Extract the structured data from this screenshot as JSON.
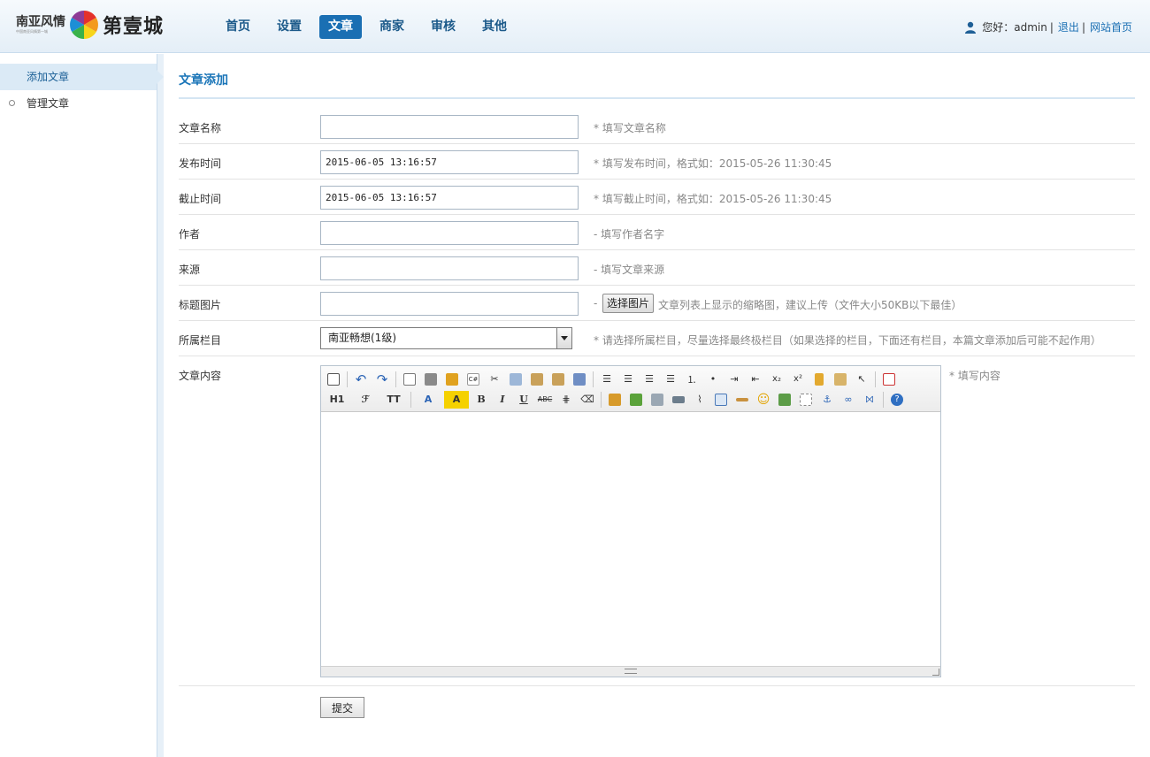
{
  "header": {
    "logo_left": "南亚风情",
    "logo_tagline": "中国南亚风情第一城",
    "logo_right": "第壹城",
    "nav": [
      {
        "label": "首页",
        "active": false
      },
      {
        "label": "设置",
        "active": false
      },
      {
        "label": "文章",
        "active": true
      },
      {
        "label": "商家",
        "active": false
      },
      {
        "label": "审核",
        "active": false
      },
      {
        "label": "其他",
        "active": false
      }
    ],
    "greeting": "您好：admin",
    "logout": "退出",
    "site_home": "网站首页",
    "separator": "|"
  },
  "sidebar": {
    "items": [
      {
        "label": "添加文章",
        "active": true
      },
      {
        "label": "管理文章",
        "active": false
      }
    ]
  },
  "main": {
    "title": "文章添加",
    "fields": {
      "name": {
        "label": "文章名称",
        "value": "",
        "hint": "* 填写文章名称"
      },
      "publish_time": {
        "label": "发布时间",
        "value": "2015-06-05 13:16:57",
        "hint": "* 填写发布时间，格式如：2015-05-26 11:30:45"
      },
      "deadline": {
        "label": "截止时间",
        "value": "2015-06-05 13:16:57",
        "hint": "* 填写截止时间，格式如：2015-05-26 11:30:45"
      },
      "author": {
        "label": "作者",
        "value": "",
        "hint": "- 填写作者名字"
      },
      "source": {
        "label": "来源",
        "value": "",
        "hint": "- 填写文章来源"
      },
      "title_image": {
        "label": "标题图片",
        "value": "",
        "dash": "-",
        "button": "选择图片",
        "hint": "文章列表上显示的缩略图，建议上传（文件大小50KB以下最佳）"
      },
      "category": {
        "label": "所属栏目",
        "selected": "南亚畅想(1级)",
        "hint": "* 请选择所属栏目，尽量选择最终极栏目（如果选择的栏目，下面还有栏目，本篇文章添加后可能不起作用）"
      },
      "content": {
        "label": "文章内容",
        "hint": "* 填写内容"
      }
    },
    "editor": {
      "toolbar_row1": [
        "source-icon",
        "undo-icon",
        "redo-icon",
        "preview-icon",
        "print-icon",
        "template-icon",
        "code-icon",
        "cut-icon",
        "copy-icon",
        "paste-icon",
        "paste-text-icon",
        "paste-word-icon",
        "align-left-icon",
        "align-center-icon",
        "align-right-icon",
        "justify-icon",
        "ordered-list-icon",
        "unordered-list-icon",
        "indent-icon",
        "outdent-icon",
        "subscript-icon",
        "superscript-icon",
        "clear-format-icon",
        "select-all-icon",
        "cursor-icon",
        "fullscreen-icon"
      ],
      "toolbar_row2_text": {
        "heading": "H1",
        "font_family": "ℱ",
        "font_size": "TT",
        "font_color": "A",
        "highlight": "A",
        "bold": "B",
        "italic": "I",
        "underline": "U",
        "strike": "ABC"
      },
      "toolbar_row2_icons": [
        "hr-icon",
        "eraser-icon",
        "image-icon",
        "multi-image-icon",
        "flash-icon",
        "media-icon",
        "attachment-icon",
        "table-icon",
        "hr-insert-icon",
        "emoticon-icon",
        "baidu-map-icon",
        "pagebreak-icon",
        "anchor-icon",
        "link-icon",
        "unlink-icon",
        "help-icon"
      ]
    },
    "submit": "提交"
  },
  "colors": {
    "accent": "#1a6fb3",
    "title": "#1a75b8",
    "sidebar_active": "#dbeaf6"
  }
}
